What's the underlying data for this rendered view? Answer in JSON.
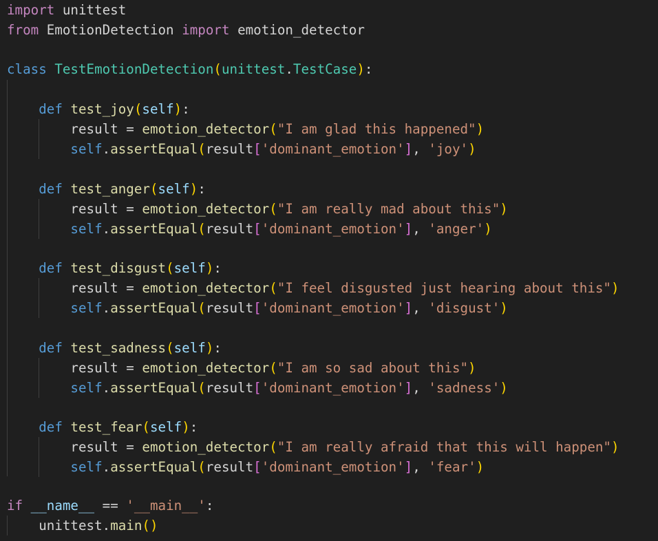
{
  "theme": {
    "background": "#1f1f1f",
    "colors": {
      "control_keyword": "#c586c0",
      "keyword": "#569cd6",
      "function": "#dcdcaa",
      "class": "#4ec9b0",
      "variable": "#9cdcfe",
      "string": "#ce9178",
      "default": "#d4d4d4",
      "bracket_level_1": "#ffd700",
      "bracket_level_2": "#da70d6",
      "indent_guide": "#404040"
    }
  },
  "code": {
    "imports": {
      "kw_import": "import",
      "mod_unittest": "unittest",
      "kw_from": "from",
      "mod_emotion": "EmotionDetection",
      "kw_import2": "import",
      "fn_emotion_detector": "emotion_detector"
    },
    "class_def": {
      "kw_class": "class",
      "name": "TestEmotionDetection",
      "base_module": "unittest",
      "base_class": "TestCase"
    },
    "tests": [
      {
        "name": "test_joy",
        "input_text": "\"I am glad this happened\"",
        "expected": "'joy'"
      },
      {
        "name": "test_anger",
        "input_text": "\"I am really mad about this\"",
        "expected": "'anger'"
      },
      {
        "name": "test_disgust",
        "input_text": "\"I feel disgusted just hearing about this\"",
        "expected": "'disgust'"
      },
      {
        "name": "test_sadness",
        "input_text": "\"I am so sad about this\"",
        "expected": "'sadness'"
      },
      {
        "name": "test_fear",
        "input_text": "\"I am really afraid that this will happen\"",
        "expected": "'fear'"
      }
    ],
    "common": {
      "kw_def": "def",
      "self": "self",
      "result_var": "result",
      "equals": " = ",
      "call_fn": "emotion_detector",
      "assert_fn": "assertEqual",
      "key": "'dominant_emotion'"
    },
    "main_block": {
      "kw_if": "if",
      "dunder_name": "__name__",
      "op": " == ",
      "main_str": "'__main__'",
      "call_module": "unittest",
      "call_fn": "main"
    }
  }
}
